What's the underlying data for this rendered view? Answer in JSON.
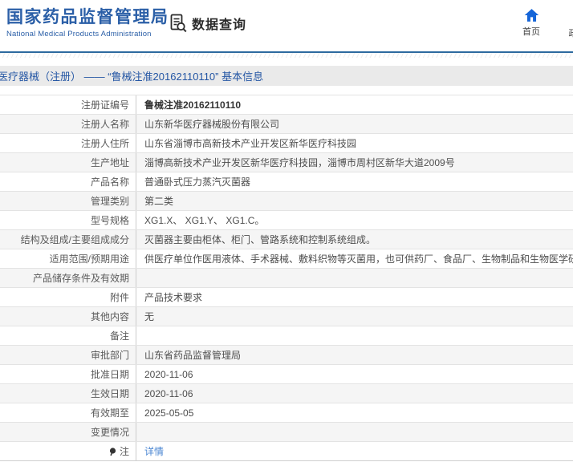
{
  "header": {
    "logo_title": "国家药品监督管理局",
    "logo_subtitle": "National Medical Products Administration",
    "data_query_label": "数据查询",
    "nav_home_label": "首页",
    "nav_next_label": "政"
  },
  "breadcrumb": {
    "text": "医疗器械（注册） —— “鲁械注准20162110110” 基本信息"
  },
  "table": {
    "rows": [
      {
        "label": "注册证编号",
        "value": "鲁械注准20162110110",
        "bold": true
      },
      {
        "label": "注册人名称",
        "value": "山东新华医疗器械股份有限公司"
      },
      {
        "label": "注册人住所",
        "value": "山东省淄博市高新技术产业开发区新华医疗科技园"
      },
      {
        "label": "生产地址",
        "value": "淄博高新技术产业开发区新华医疗科技园，淄博市周村区新华大道2009号"
      },
      {
        "label": "产品名称",
        "value": "普通卧式压力蒸汽灭菌器"
      },
      {
        "label": "管理类别",
        "value": "第二类"
      },
      {
        "label": "型号规格",
        "value": "XG1.X、 XG1.Y、 XG1.C。"
      },
      {
        "label": "结构及组成/主要组成成分",
        "value": "灭菌器主要由柜体、柜门、管路系统和控制系统组成。"
      },
      {
        "label": "适用范围/预期用途",
        "value": "供医疗单位作医用液体、手术器械、敷料织物等灭菌用，也可供药厂、食品厂、生物制品和生物医学研究机构灭菌用。"
      },
      {
        "label": "产品储存条件及有效期",
        "value": ""
      },
      {
        "label": "附件",
        "value": "产品技术要求"
      },
      {
        "label": "其他内容",
        "value": "无"
      },
      {
        "label": "备注",
        "value": ""
      },
      {
        "label": "审批部门",
        "value": "山东省药品监督管理局"
      },
      {
        "label": "批准日期",
        "value": "2020-11-06"
      },
      {
        "label": "生效日期",
        "value": "2020-11-06"
      },
      {
        "label": "有效期至",
        "value": "2025-05-05"
      },
      {
        "label": "变更情况",
        "value": ""
      },
      {
        "label": "注",
        "value": "详情",
        "link": true,
        "icon": "note-icon"
      }
    ]
  },
  "colors": {
    "brand_blue": "#2b5fa7",
    "header_rule_blue": "#2d6a9f",
    "breadcrumb_text_blue": "#2456a4",
    "link_blue": "#4a86d2",
    "home_icon_blue": "#1565d8",
    "row_stripe_gray": "#f5f5f5"
  }
}
